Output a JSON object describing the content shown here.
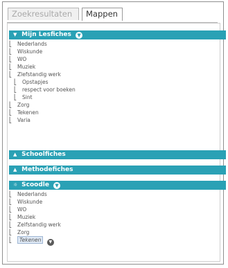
{
  "tabs": {
    "search_results": "Zoekresultaten",
    "folders": "Mappen"
  },
  "icons": {
    "collapse": "▼",
    "expand": "▲",
    "dropdown": "▼",
    "folder": "folder-icon",
    "folder_open": "folder-open-icon",
    "scoodle_logo": "☼"
  },
  "colors": {
    "header_bg": "#2aa1b5",
    "header_text": "#ffffff"
  },
  "sections": {
    "mijn_lesfiches": {
      "title": "Mijn Lesfiches",
      "items": [
        {
          "label": "Nederlands"
        },
        {
          "label": "Wiskunde"
        },
        {
          "label": "WO"
        },
        {
          "label": "Muziek"
        },
        {
          "label": "Zlefstandig werk",
          "open": true
        },
        {
          "label": "Opstapjes",
          "level": 2
        },
        {
          "label": "respect voor boeken",
          "level": 2
        },
        {
          "label": "Sint",
          "level": 2
        },
        {
          "label": "Zorg"
        },
        {
          "label": "Tekenen"
        },
        {
          "label": "Varia",
          "open": true
        }
      ]
    },
    "schoolfiches": {
      "title": "Schoolfiches"
    },
    "methodefiches": {
      "title": "Methodefiches"
    },
    "scoodle": {
      "title": "Scoodle",
      "items": [
        {
          "label": "Nederlands"
        },
        {
          "label": "Wiskunde"
        },
        {
          "label": "WO"
        },
        {
          "label": "Muziek"
        },
        {
          "label": "Zelfstandig werk"
        },
        {
          "label": "Zorg"
        },
        {
          "label": "Tekenen",
          "selected": true
        }
      ]
    }
  }
}
